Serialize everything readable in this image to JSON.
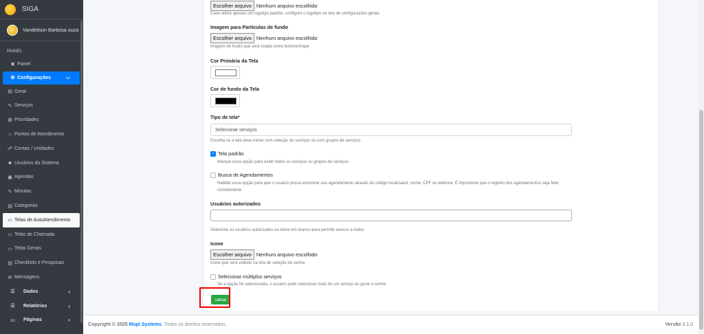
{
  "brand": {
    "name": "SIGA"
  },
  "user": {
    "name": "Vandeilson Barbosa ouza"
  },
  "sidebar": {
    "header": "PAINEL",
    "items": [
      {
        "label": "Painel",
        "icon": "dashboard-icon",
        "glyph": "◉"
      },
      {
        "label": "Configurações",
        "icon": "cogs-icon",
        "glyph": "⚙",
        "chevron": "⌄"
      },
      {
        "label": "Geral",
        "icon": "print-icon",
        "glyph": "▤"
      },
      {
        "label": "Serviços",
        "icon": "wrench-icon",
        "glyph": "✎"
      },
      {
        "label": "Prioridades",
        "icon": "star-circle-icon",
        "glyph": "✪"
      },
      {
        "label": "Pontos de Atendimento",
        "icon": "home-icon",
        "glyph": "⌂"
      },
      {
        "label": "Contas / Unidades",
        "icon": "sitemap-icon",
        "glyph": "☍"
      },
      {
        "label": "Usuários do Sistema",
        "icon": "users-icon",
        "glyph": "☻"
      },
      {
        "label": "Agendas",
        "icon": "calendar-icon",
        "glyph": "▣"
      },
      {
        "label": "Minutas",
        "icon": "edit-icon",
        "glyph": "✎"
      },
      {
        "label": "Categorias",
        "icon": "list-icon",
        "glyph": "▤"
      },
      {
        "label": "Telas de AutoAtendimento",
        "icon": "desktop-icon",
        "glyph": "▭"
      },
      {
        "label": "Telas de Chamada",
        "icon": "desktop-icon",
        "glyph": "▭"
      },
      {
        "label": "Telas Gerais",
        "icon": "desktop-icon",
        "glyph": "▭"
      },
      {
        "label": "Checklists e Pesquisas",
        "icon": "id-card-icon",
        "glyph": "▤"
      },
      {
        "label": "Mensagens",
        "icon": "envelope-icon",
        "glyph": "✉"
      },
      {
        "label": "Dados",
        "icon": "database-icon",
        "glyph": "☰",
        "chevron": "‹"
      },
      {
        "label": "Relatórios",
        "icon": "chart-icon",
        "glyph": "☰",
        "chevron": "‹"
      },
      {
        "label": "Páginas",
        "icon": "desktop-icon",
        "glyph": "▭",
        "chevron": "‹"
      }
    ]
  },
  "form": {
    "logo_file": {
      "button": "Escolher arquivo",
      "status": "Nenhum arquivo escolhido",
      "help": "Caso utilize apenas um logotipo padrão, configure o logotipo na tela de configurações gerais"
    },
    "particles": {
      "label": "Imagem para Partículas de fundo",
      "button": "Escolher arquivo",
      "status": "Nenhum arquivo escolhido",
      "help": "Imagem de fundo que será usada como textura/shape"
    },
    "primary_color": {
      "label": "Cor Primária da Tela",
      "value": "#ffffff"
    },
    "bg_color": {
      "label": "Cor de fundo da Tela",
      "value": "#000000"
    },
    "screen_type": {
      "label": "Tipo de tela*",
      "placeholder": "Selecionar serviços",
      "help": "Escolha se a tela deve iniciar com seleção de serviços ou com grupos de serviços"
    },
    "default_screen": {
      "label": "Tela padrão",
      "checked": true,
      "help": "Marque essa opção para exibir todos os serviços ou grupos de serviços"
    },
    "booking_search": {
      "label": "Busca de Agendamentos",
      "checked": false,
      "help": "Habilite essa opção para que o usuário possa encontrar seu agendamento através do código localizador, nome, CPF ou telefone. É importante que o registro dos agendamentos seja feito",
      "help2": "corretamente"
    },
    "authorized_users": {
      "label": "Usuários autorizados",
      "help": "Selecione os usuários autorizados ou deixe em branco para permitir acesso a todos"
    },
    "icon_file": {
      "label": "Icone",
      "button": "Escolher arquivo",
      "status": "Nenhum arquivo escolhido",
      "help": "Icone que será exibido na tela de seleção de senha"
    },
    "multi_services": {
      "label": "Selecionar múltiplos serviços",
      "checked": false,
      "help": "Se a opção for selecionada, o usuário pode selecionar mais de um serviço ao gerar a senha"
    },
    "save": "salvar"
  },
  "footer": {
    "copyright": "Copyright © 2025",
    "company": "Mupi Systems.",
    "rights": "Todos os direitos reservados.",
    "version_label": "Versão",
    "version": "3.1.0"
  },
  "colors": {
    "accent": "#007bff",
    "success": "#28a745",
    "sidebar": "#343a40",
    "highlight": "#ee0000"
  }
}
